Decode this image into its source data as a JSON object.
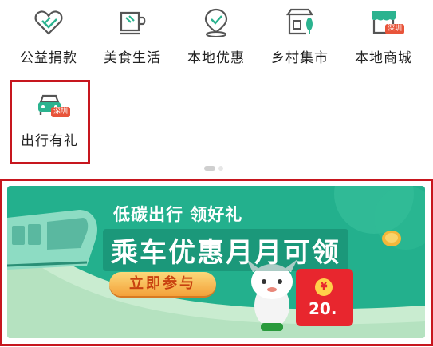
{
  "services_row1": [
    {
      "label": "公益捐款",
      "icon": "charity-hands-icon"
    },
    {
      "label": "美食生活",
      "icon": "coffee-cup-icon"
    },
    {
      "label": "本地优惠",
      "icon": "location-pin-icon"
    },
    {
      "label": "乡村集市",
      "icon": "market-stall-icon"
    },
    {
      "label": "本地商城",
      "icon": "shop-icon",
      "badge": "深圳"
    }
  ],
  "services_row2": [
    {
      "label": "出行有礼",
      "icon": "car-icon",
      "badge": "深圳"
    }
  ],
  "banner": {
    "subtitle": "低碳出行 领好礼",
    "title": "乘车优惠月月可领",
    "cta": "立即参与",
    "coupon_amount": "20.",
    "coupon_symbol": "¥"
  },
  "colors": {
    "accent_green": "#2bb38f",
    "banner_green": "#23b08d",
    "highlight_red": "#c7161e",
    "badge_red": "#e8543a"
  }
}
